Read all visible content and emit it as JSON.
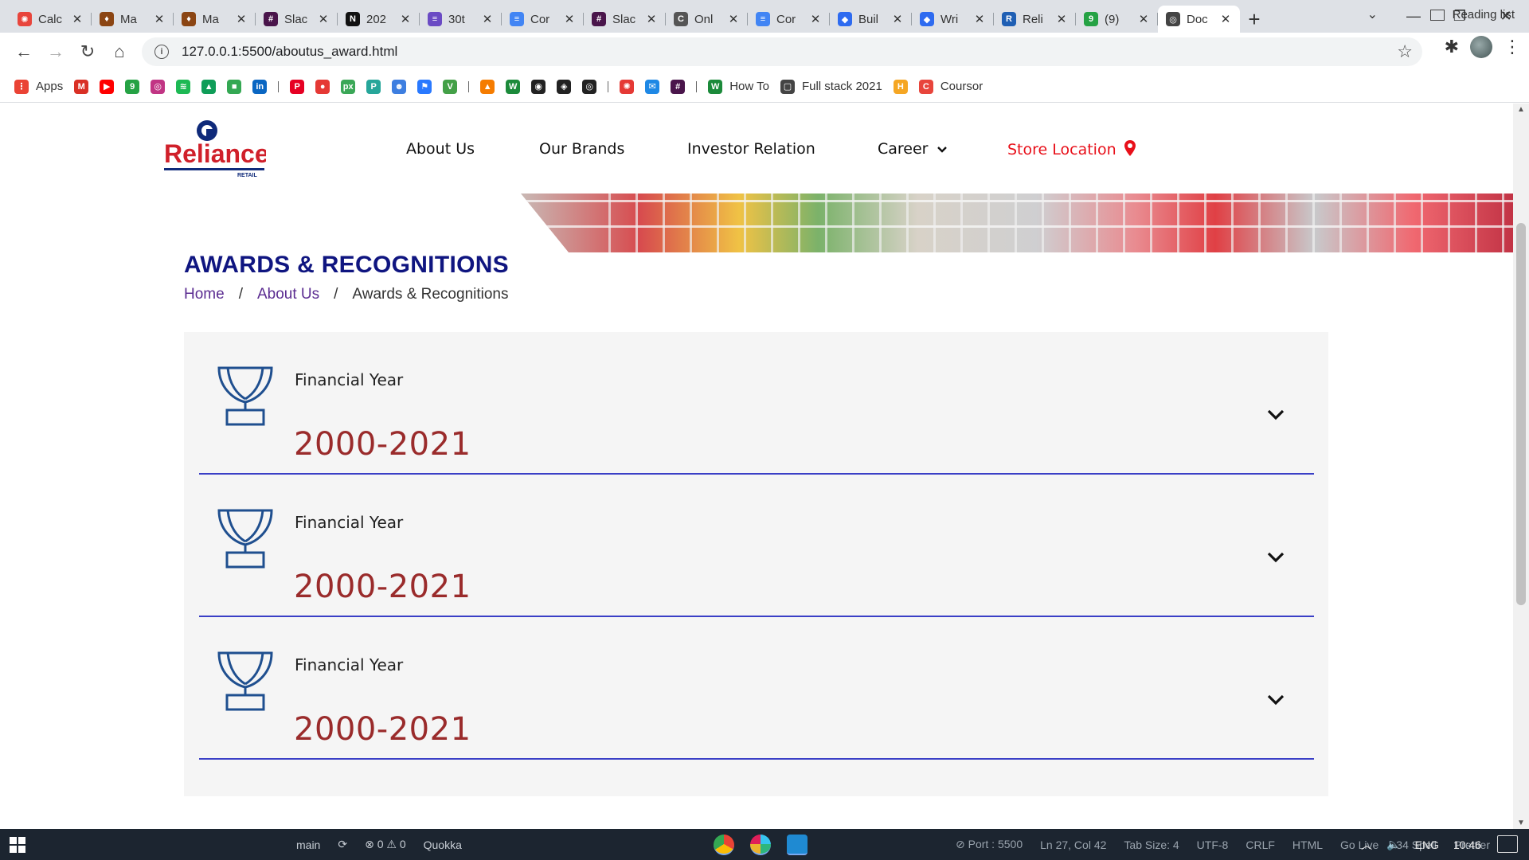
{
  "browser": {
    "tabs": [
      {
        "label": "Calc",
        "color": "#e8453c",
        "glyph": "✺"
      },
      {
        "label": "Ma",
        "color": "#8b4513",
        "glyph": "♦"
      },
      {
        "label": "Ma",
        "color": "#8b4513",
        "glyph": "♦"
      },
      {
        "label": "Slac",
        "color": "#4a154b",
        "glyph": "#"
      },
      {
        "label": "202",
        "color": "#111111",
        "glyph": "N"
      },
      {
        "label": "30t",
        "color": "#6b4bc4",
        "glyph": "≡"
      },
      {
        "label": "Cor",
        "color": "#4285f4",
        "glyph": "≡"
      },
      {
        "label": "Slac",
        "color": "#4a154b",
        "glyph": "#"
      },
      {
        "label": "Onl",
        "color": "#555555",
        "glyph": "C"
      },
      {
        "label": "Cor",
        "color": "#4285f4",
        "glyph": "≡"
      },
      {
        "label": "Buil",
        "color": "#2e6bf0",
        "glyph": "◆"
      },
      {
        "label": "Wri",
        "color": "#2e6bf0",
        "glyph": "◆"
      },
      {
        "label": "Reli",
        "color": "#1f5fb4",
        "glyph": "R"
      },
      {
        "label": "(9)",
        "color": "#25a244",
        "glyph": "9"
      },
      {
        "label": "Doc",
        "color": "#444444",
        "glyph": "◎",
        "active": true
      }
    ],
    "close_glyph": "✕",
    "new_tab_glyph": "+",
    "url": "127.0.0.1:5500/aboutus_award.html",
    "bookmarks": [
      {
        "label": "Apps",
        "color": "#ea4335",
        "glyph": "⋮"
      },
      {
        "label": "",
        "color": "#d93025",
        "glyph": "M"
      },
      {
        "label": "",
        "color": "#ff0000",
        "glyph": "▶"
      },
      {
        "label": "",
        "color": "#25a244",
        "glyph": "9"
      },
      {
        "label": "",
        "color": "#c13584",
        "glyph": "◎"
      },
      {
        "label": "",
        "color": "#1db954",
        "glyph": "≋"
      },
      {
        "label": "",
        "color": "#0f9d58",
        "glyph": "▲"
      },
      {
        "label": "",
        "color": "#34a853",
        "glyph": "■"
      },
      {
        "label": "",
        "color": "#0a66c2",
        "glyph": "in"
      },
      {
        "label": "",
        "color": "#e60023",
        "glyph": "P"
      },
      {
        "label": "",
        "color": "#e53935",
        "glyph": "●"
      },
      {
        "label": "",
        "color": "#3aa757",
        "glyph": "px"
      },
      {
        "label": "",
        "color": "#26a69a",
        "glyph": "P"
      },
      {
        "label": "",
        "color": "#3d7ee0",
        "glyph": "☻"
      },
      {
        "label": "",
        "color": "#2979ff",
        "glyph": "⚑"
      },
      {
        "label": "",
        "color": "#43a047",
        "glyph": "V"
      },
      {
        "label": "",
        "color": "#f57c00",
        "glyph": "▲"
      },
      {
        "label": "",
        "color": "#1b8a3a",
        "glyph": "W"
      },
      {
        "label": "",
        "color": "#222222",
        "glyph": "◉"
      },
      {
        "label": "",
        "color": "#222222",
        "glyph": "◈"
      },
      {
        "label": "",
        "color": "#222222",
        "glyph": "◎"
      },
      {
        "label": "",
        "color": "#e53935",
        "glyph": "✺"
      },
      {
        "label": "",
        "color": "#1e88e5",
        "glyph": "✉"
      },
      {
        "label": "",
        "color": "#4a154b",
        "glyph": "#"
      },
      {
        "label": "How To",
        "color": "#1b8a3a",
        "glyph": "W"
      },
      {
        "label": "Full stack 2021",
        "color": "#444444",
        "glyph": "▢"
      },
      {
        "label": "",
        "color": "#f5a623",
        "glyph": "H"
      },
      {
        "label": "Coursor",
        "color": "#e8453c",
        "glyph": "C"
      }
    ],
    "reading_list": "Reading list"
  },
  "site": {
    "logo_text": "Reliance",
    "logo_subtext": "RETAIL",
    "nav": {
      "about": "About Us",
      "brands": "Our Brands",
      "investor": "Investor Relation",
      "career": "Career",
      "store": "Store Location"
    },
    "page_title": "AWARDS & RECOGNITIONS",
    "breadcrumb": {
      "home": "Home",
      "sep": "/",
      "about": "About Us",
      "current": "Awards & Recognitions"
    },
    "awards": [
      {
        "label": "Financial Year",
        "value": "2000-2021"
      },
      {
        "label": "Financial Year",
        "value": "2000-2021"
      },
      {
        "label": "Financial Year",
        "value": "2000-2021"
      }
    ],
    "colors": {
      "title": "#0f1580",
      "year": "#9a2b2b",
      "store": "#e8101a",
      "divider": "#3a3fc6"
    }
  },
  "taskbar": {
    "vscode_status": [
      "main",
      "⟳",
      "⊗ 0 ⚠ 0",
      "Quokka"
    ],
    "vscode_right": [
      "⊘ Port : 5500",
      "Ln 27, Col 42",
      "Tab Size: 4",
      "UTF-8",
      "CRLF",
      "HTML",
      "Go Live",
      "34 Spell",
      "Prettier"
    ],
    "lang": "ENG",
    "time": "10:46"
  }
}
